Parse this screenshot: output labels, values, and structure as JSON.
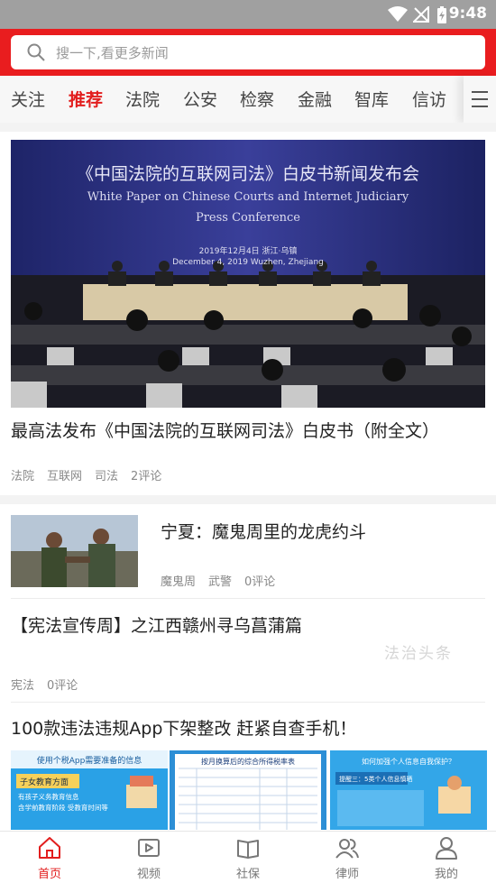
{
  "status_bar": {
    "time": "9:48"
  },
  "search": {
    "placeholder": "搜一下,看更多新闻"
  },
  "tabs": [
    {
      "label": "关注"
    },
    {
      "label": "推荐"
    },
    {
      "label": "法院"
    },
    {
      "label": "公安"
    },
    {
      "label": "检察"
    },
    {
      "label": "金融"
    },
    {
      "label": "智库"
    },
    {
      "label": "信访"
    }
  ],
  "hero": {
    "banner_cn": "《中国法院的互联网司法》白皮书新闻发布会",
    "banner_en1": "White Paper on Chinese Courts and Internet Judiciary",
    "banner_en2": "Press Conference",
    "banner_date": "2019年12月4日    浙江·乌镇",
    "banner_date_en": "December 4, 2019    Wuzhen, Zhejiang"
  },
  "articles": [
    {
      "title": "最高法发布《中国法院的互联网司法》白皮书（附全文）",
      "tags": [
        "法院",
        "互联网",
        "司法"
      ],
      "comments": "2评论"
    },
    {
      "title": "宁夏：魔鬼周里的龙虎约斗",
      "tags": [
        "魔鬼周",
        "武警"
      ],
      "comments": "0评论"
    },
    {
      "title": "【宪法宣传周】之江西赣州寻乌菖蒲篇",
      "tags": [
        "宪法"
      ],
      "comments": "0评论",
      "watermark": "法治头条"
    },
    {
      "title": "100款违法违规App下架整改 赶紧自查手机！"
    }
  ],
  "thumbs3": [
    {
      "head": "使用个税App需要准备的信息",
      "line1": "子女教育方面",
      "line2": "有孩子义务教育信息",
      "line3": "含学前教育阶段 受教育时间等"
    },
    {
      "head": "按月换算后的综合所得税率表"
    },
    {
      "head": "如何加强个人信息自我保护？",
      "line1": "提醒三：5类个人信息慎晒"
    }
  ],
  "bottom_nav": [
    {
      "label": "首页"
    },
    {
      "label": "视频"
    },
    {
      "label": "社保"
    },
    {
      "label": "律师"
    },
    {
      "label": "我的"
    }
  ],
  "colors": {
    "brand_red": "#e91d1f",
    "active_text": "#e21e1e"
  }
}
